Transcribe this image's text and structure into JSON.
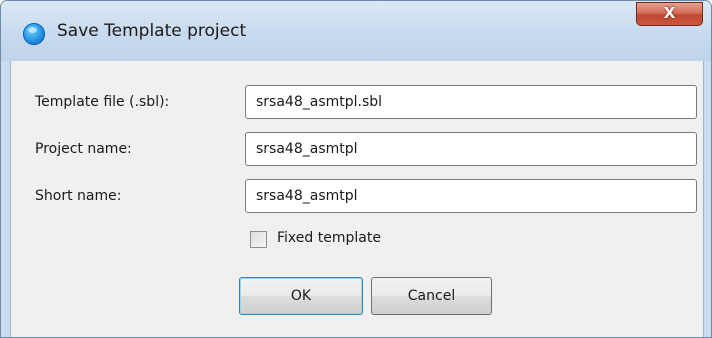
{
  "window": {
    "title": "Save Template project",
    "close_label": "X"
  },
  "form": {
    "template_file": {
      "label": "Template file (.sbl):",
      "value": "srsa48_asmtpl.sbl"
    },
    "project_name": {
      "label": "Project name:",
      "value": "srsa48_asmtpl"
    },
    "short_name": {
      "label": "Short name:",
      "value": "srsa48_asmtpl"
    },
    "fixed_template": {
      "label": "Fixed template",
      "checked": false
    }
  },
  "buttons": {
    "ok_label": "OK",
    "cancel_label": "Cancel"
  },
  "icons": {
    "app": "app-globe-icon",
    "close": "close-icon"
  },
  "colors": {
    "titlebar": "#c9dcef",
    "client": "#f0f0f0",
    "close_button": "#c9573e",
    "ok_focus_border": "#3c7fb1"
  }
}
